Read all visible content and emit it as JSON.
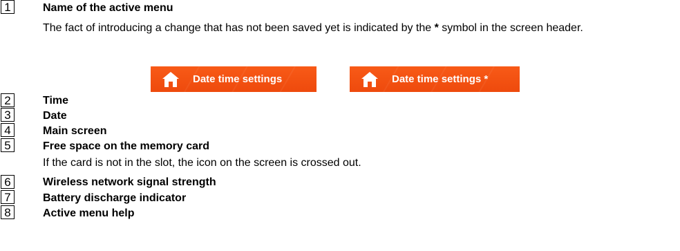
{
  "items": [
    {
      "num": "1",
      "title": "Name of the active menu",
      "desc_pre": "The fact of introducing a change that has not been saved yet is indicated by the ",
      "desc_symbol": "*",
      "desc_post": " symbol in the screen header."
    },
    {
      "num": "2",
      "title": "Time"
    },
    {
      "num": "3",
      "title": "Date"
    },
    {
      "num": "4",
      "title": "Main screen"
    },
    {
      "num": "5",
      "title": "Free space on the memory card",
      "desc": "If the card is not in the slot, the icon on the screen is crossed out."
    },
    {
      "num": "6",
      "title": "Wireless network signal strength"
    },
    {
      "num": "7",
      "title": "Battery discharge indicator"
    },
    {
      "num": "8",
      "title": "Active menu help"
    }
  ],
  "banners": [
    {
      "label": "Date time settings",
      "icon": "home-icon"
    },
    {
      "label": "Date time settings *",
      "icon": "home-icon"
    }
  ],
  "colors": {
    "banner": "#f4561a",
    "banner_text": "#ffffff"
  }
}
